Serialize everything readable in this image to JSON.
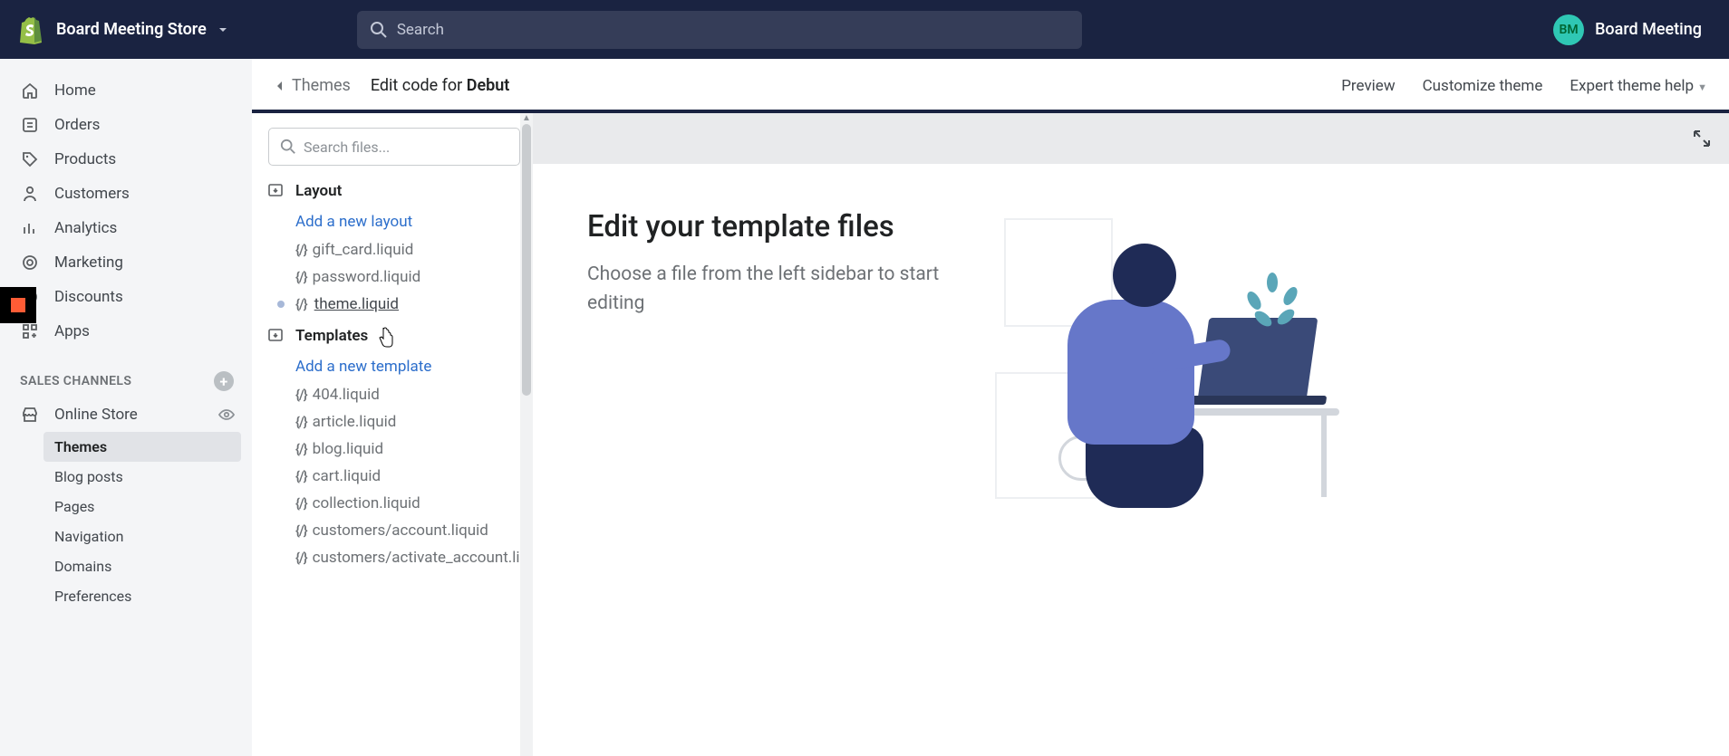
{
  "topbar": {
    "store_name": "Board Meeting Store",
    "search_placeholder": "Search",
    "user_initials": "BM",
    "user_name": "Board Meeting"
  },
  "nav": {
    "items": [
      {
        "label": "Home",
        "icon": "home"
      },
      {
        "label": "Orders",
        "icon": "orders"
      },
      {
        "label": "Products",
        "icon": "products"
      },
      {
        "label": "Customers",
        "icon": "customers"
      },
      {
        "label": "Analytics",
        "icon": "analytics"
      },
      {
        "label": "Marketing",
        "icon": "marketing"
      },
      {
        "label": "Discounts",
        "icon": "discounts"
      },
      {
        "label": "Apps",
        "icon": "apps"
      }
    ],
    "section_title": "SALES CHANNELS",
    "channel": {
      "label": "Online Store"
    },
    "subs": [
      {
        "label": "Themes",
        "active": true
      },
      {
        "label": "Blog posts"
      },
      {
        "label": "Pages"
      },
      {
        "label": "Navigation"
      },
      {
        "label": "Domains"
      },
      {
        "label": "Preferences"
      }
    ]
  },
  "main_head": {
    "back_label": "Themes",
    "crumb_prefix": "Edit code for ",
    "crumb_theme": "Debut",
    "actions": {
      "preview": "Preview",
      "customize": "Customize theme",
      "expert": "Expert theme help"
    }
  },
  "file_panel": {
    "search_placeholder": "Search files...",
    "sections": [
      {
        "title": "Layout",
        "add_label": "Add a new layout",
        "files": [
          {
            "name": "gift_card.liquid"
          },
          {
            "name": "password.liquid"
          },
          {
            "name": "theme.liquid",
            "modified": true,
            "hover": true
          }
        ]
      },
      {
        "title": "Templates",
        "add_label": "Add a new template",
        "files": [
          {
            "name": "404.liquid"
          },
          {
            "name": "article.liquid"
          },
          {
            "name": "blog.liquid"
          },
          {
            "name": "cart.liquid"
          },
          {
            "name": "collection.liquid"
          },
          {
            "name": "customers/account.liquid"
          },
          {
            "name": "customers/activate_account.liquid"
          }
        ]
      }
    ]
  },
  "editor": {
    "heading": "Edit your template files",
    "subtext": "Choose a file from the left sidebar to start editing"
  }
}
